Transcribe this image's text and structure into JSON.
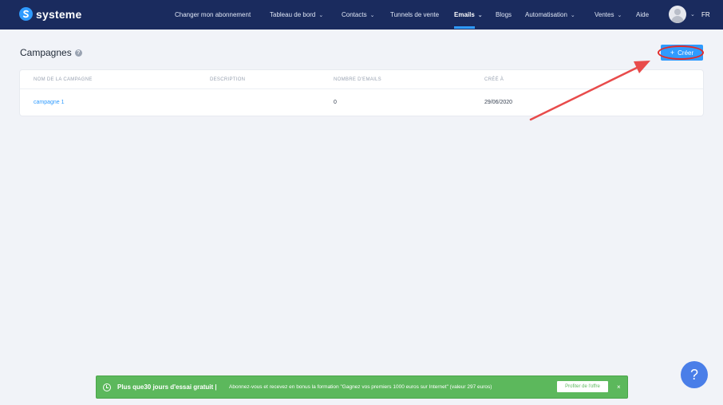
{
  "app": {
    "brand": "systeme"
  },
  "nav": {
    "items": [
      {
        "label": "Changer mon abonnement",
        "has_chevron": false
      },
      {
        "label": "Tableau de bord",
        "has_chevron": true
      },
      {
        "label": "Contacts",
        "has_chevron": true
      },
      {
        "label": "Tunnels de vente",
        "has_chevron": false
      },
      {
        "label": "Emails",
        "has_chevron": true,
        "active": true
      },
      {
        "label": "Blogs",
        "has_chevron": false
      },
      {
        "label": "Automatisation",
        "has_chevron": true
      },
      {
        "label": "Ventes",
        "has_chevron": true
      },
      {
        "label": "Aide",
        "has_chevron": false
      }
    ],
    "chevron": "⌄",
    "language": "FR"
  },
  "page": {
    "title": "Campagnes",
    "help_icon": "?",
    "create_button": {
      "plus": "+",
      "label": "Créer"
    }
  },
  "table": {
    "columns": [
      "NOM DE LA CAMPAGNE",
      "DESCRIPTION",
      "NOMBRE D'EMAILS",
      "CRÉÉ À"
    ],
    "rows": [
      {
        "name": "campagne 1",
        "description": "",
        "emails": "0",
        "created": "29/06/2020"
      }
    ]
  },
  "promo": {
    "headline": "Plus que30 jours d'essai gratuit |",
    "text": "Abonnez-vous et recevez en bonus la formation \"Gagnez vos premiers 1000 euros sur Internet\" (valeur 297 euros)",
    "button": "Profiter de l'offre",
    "close": "×"
  },
  "help_fab": "?",
  "colors": {
    "nav_bg": "#1a2b5e",
    "accent": "#2f9bff",
    "promo_green": "#5cb85c",
    "annotation_red": "#e02b2b",
    "page_bg": "#f1f3f8"
  }
}
